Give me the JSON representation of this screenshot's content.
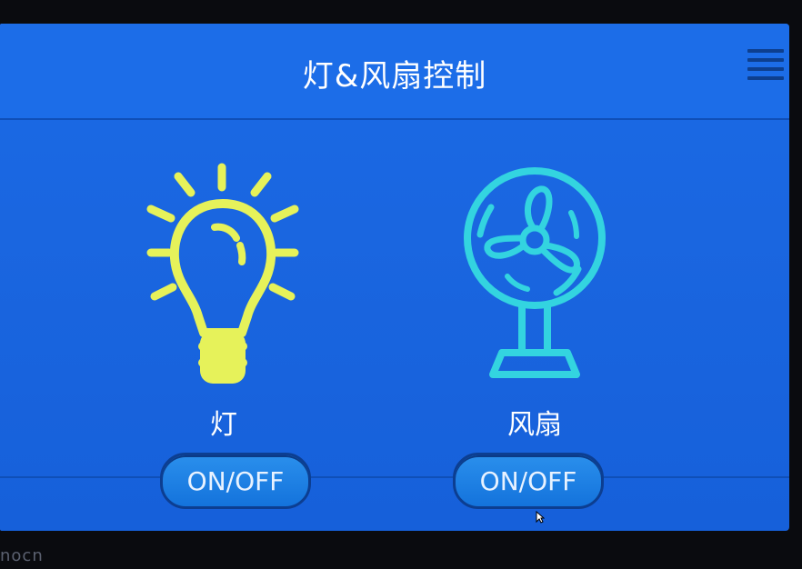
{
  "screen": {
    "title": "灯&风扇控制"
  },
  "devices": [
    {
      "name": "灯",
      "icon": "lightbulb-icon",
      "button_label": "ON/OFF",
      "color": "#e6f25a"
    },
    {
      "name": "风扇",
      "icon": "fan-icon",
      "button_label": "ON/OFF",
      "color": "#33d4e0"
    }
  ],
  "brand_text": "nocn",
  "colors": {
    "background": "#1a66e0",
    "header_line": "#0f4fb8",
    "button": "#1f84e6"
  }
}
